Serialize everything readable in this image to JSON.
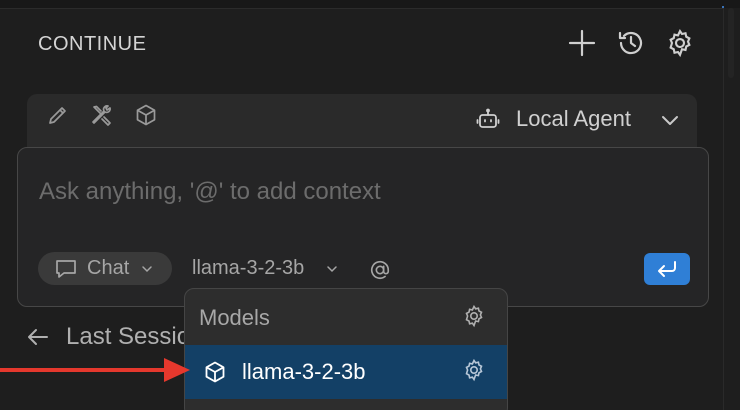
{
  "header": {
    "title": "CONTINUE",
    "new_icon": "plus-icon",
    "history_icon": "history-icon",
    "settings_icon": "gear-icon"
  },
  "toolbar": {
    "tool_icons": [
      "pencil-icon",
      "tools-icon",
      "cube-icon"
    ],
    "agent_icon": "robot-icon",
    "agent_label": "Local Agent"
  },
  "input": {
    "placeholder": "Ask anything, '@' to add context",
    "value": ""
  },
  "input_toolbar": {
    "mode_label": "Chat",
    "model_label": "llama-3-2-3b",
    "mention_symbol": "@"
  },
  "back": {
    "label": "Last Session"
  },
  "dropdown": {
    "header": "Models",
    "items": [
      {
        "label": "llama-3-2-3b",
        "selected": true
      }
    ]
  },
  "colors": {
    "background": "#1e1e1e",
    "accent": "#2f7fd6",
    "selected_item": "#134066",
    "annotation_arrow": "#e5382d"
  }
}
